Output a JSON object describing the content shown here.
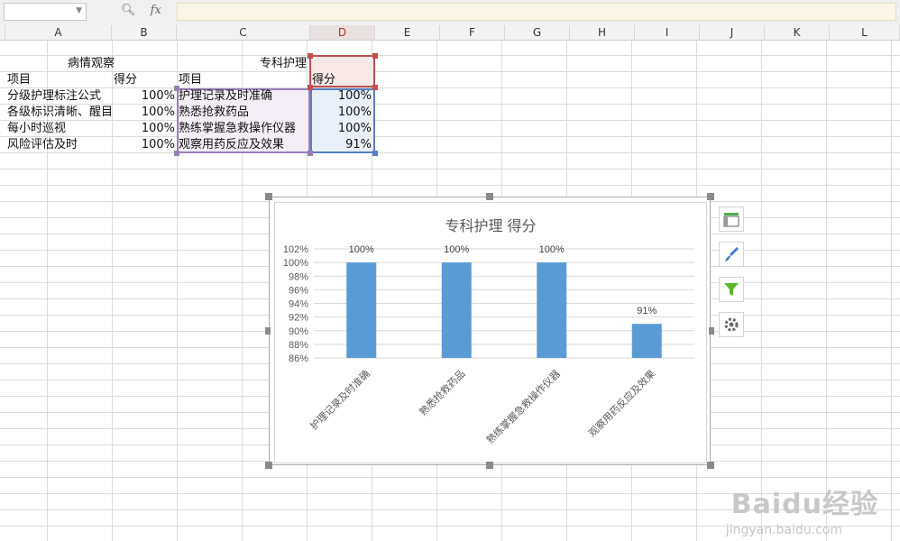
{
  "formula_bar": {
    "fx_label": "fx",
    "name_value": "",
    "formula_value": ""
  },
  "columns": [
    "A",
    "B",
    "C",
    "D",
    "E",
    "F",
    "G",
    "H",
    "I",
    "J",
    "K",
    "L"
  ],
  "sheet": {
    "header1_a": "病情观察",
    "header1_c": "专科护理",
    "r2": [
      "项目",
      "得分",
      "项目",
      "得分"
    ],
    "rows": [
      {
        "a": "分级护理标注公式",
        "b": "100%",
        "c": "护理记录及时准确",
        "d": "100%"
      },
      {
        "a": "各级标识清晰、醒目",
        "b": "100%",
        "c": "熟悉抢救药品",
        "d": "100%"
      },
      {
        "a": "每小时巡视",
        "b": "100%",
        "c": "熟练掌握急救操作仪器",
        "d": "100%"
      },
      {
        "a": "风险评估及时",
        "b": "100%",
        "c": "观察用药反应及效果",
        "d": "91%"
      }
    ]
  },
  "chart_data": {
    "type": "bar",
    "title": "专科护理 得分",
    "categories": [
      "护理记录及时准确",
      "熟悉抢救药品",
      "熟练掌握急救操作仪器",
      "观察用药反应及效果"
    ],
    "values": [
      100,
      100,
      100,
      91
    ],
    "data_labels": [
      "100%",
      "100%",
      "100%",
      "91%"
    ],
    "yticks": [
      "86%",
      "88%",
      "90%",
      "92%",
      "94%",
      "96%",
      "98%",
      "100%",
      "102%"
    ],
    "ylim": [
      86,
      102
    ],
    "grid": true,
    "bar_color": "#5b9bd5"
  },
  "tools": [
    "chart-elements-icon",
    "chart-style-icon",
    "chart-filter-icon",
    "chart-settings-icon"
  ],
  "watermark": {
    "brand": "Baidu经验",
    "url": "jingyan.baidu.com"
  }
}
